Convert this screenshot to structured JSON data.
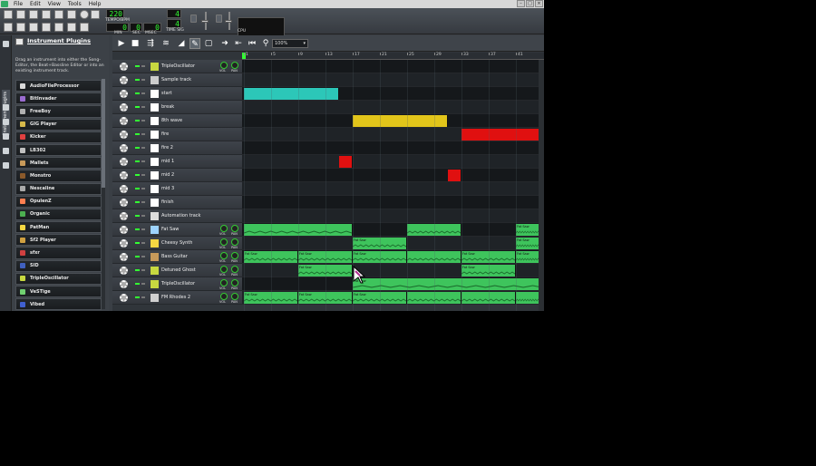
{
  "menubar": {
    "items": [
      "File",
      "Edit",
      "View",
      "Tools",
      "Help"
    ],
    "window_buttons": [
      "–",
      "□",
      "×"
    ]
  },
  "toolbar": {
    "tempo": "220",
    "tempo_label": "TEMPO/BPM",
    "time_min": "0",
    "time_sec": "0",
    "time_msec": "0",
    "min_label": "MIN",
    "sec_label": "SEC",
    "msec_label": "MSEC",
    "timesig_num": "4",
    "timesig_den": "4",
    "timesig_label": "TIME SIG",
    "cpu_label": "CPU"
  },
  "side_tab": {
    "label": "Instrument Plugins"
  },
  "plugins": {
    "title": "Instrument Plugins",
    "description": "Drag an instrument into either the Song-Editor, the Beat+Bassline Editor or into an existing instrument track.",
    "items": [
      {
        "name": "AudioFileProcessor",
        "color": "#d9d9d9"
      },
      {
        "name": "BitInvader",
        "color": "#9a6cd0"
      },
      {
        "name": "FreeBoy",
        "color": "#b0b0b0"
      },
      {
        "name": "GIG Player",
        "color": "#d7b94a"
      },
      {
        "name": "Kicker",
        "color": "#e04040"
      },
      {
        "name": "LB302",
        "color": "#c0c0c0"
      },
      {
        "name": "Mallets",
        "color": "#c89a5a"
      },
      {
        "name": "Monstro",
        "color": "#8b5a2b"
      },
      {
        "name": "Nescaline",
        "color": "#aaaaaa"
      },
      {
        "name": "OpulenZ",
        "color": "#ff7f50"
      },
      {
        "name": "Organic",
        "color": "#4caf50"
      },
      {
        "name": "PatMan",
        "color": "#f5d742"
      },
      {
        "name": "Sf2 Player",
        "color": "#d0a040"
      },
      {
        "name": "sfxr",
        "color": "#d04040"
      },
      {
        "name": "SID",
        "color": "#4060c0"
      },
      {
        "name": "TripleOscillator",
        "color": "#c8d840"
      },
      {
        "name": "VeSTige",
        "color": "#70d070"
      },
      {
        "name": "Vibed",
        "color": "#4060d0"
      }
    ]
  },
  "song_editor": {
    "zoom": "100%",
    "timeline_ticks": [
      "1",
      "5",
      "9",
      "13",
      "17",
      "21",
      "25",
      "29",
      "33",
      "37",
      "41"
    ],
    "tracks": [
      {
        "name": "TripleOscillator",
        "type": "instrument",
        "icon_color": "#c8d840",
        "knobs": true
      },
      {
        "name": "Sample track",
        "type": "sample",
        "icon_color": "#cccccc",
        "knobs": false
      },
      {
        "name": "start",
        "type": "bb",
        "icon_color": "#ffffff",
        "knobs": false
      },
      {
        "name": "break",
        "type": "bb",
        "icon_color": "#ffffff",
        "knobs": false
      },
      {
        "name": "8th wave",
        "type": "bb",
        "icon_color": "#ffffff",
        "knobs": false
      },
      {
        "name": "fire",
        "type": "bb",
        "icon_color": "#ffffff",
        "knobs": false
      },
      {
        "name": "fire 2",
        "type": "bb",
        "icon_color": "#ffffff",
        "knobs": false
      },
      {
        "name": "mid 1",
        "type": "bb",
        "icon_color": "#ffffff",
        "knobs": false
      },
      {
        "name": "mid 2",
        "type": "bb",
        "icon_color": "#ffffff",
        "knobs": false
      },
      {
        "name": "mid 3",
        "type": "bb",
        "icon_color": "#ffffff",
        "knobs": false
      },
      {
        "name": "finish",
        "type": "bb",
        "icon_color": "#ffffff",
        "knobs": false
      },
      {
        "name": "Automation track",
        "type": "automation",
        "icon_color": "#dddddd",
        "knobs": false
      },
      {
        "name": "Fat Saw",
        "type": "instrument",
        "icon_color": "#9dd3ff",
        "knobs": true
      },
      {
        "name": "Cheesy Synth",
        "type": "instrument",
        "icon_color": "#f5d742",
        "knobs": true
      },
      {
        "name": "Bass Guitar",
        "type": "instrument",
        "icon_color": "#c89a5a",
        "knobs": true
      },
      {
        "name": "Detuned Ghost",
        "type": "instrument",
        "icon_color": "#c8d840",
        "knobs": true
      },
      {
        "name": "TripleOscillator",
        "type": "instrument",
        "icon_color": "#c8d840",
        "knobs": true
      },
      {
        "name": "FM Rhodes 2",
        "type": "instrument",
        "icon_color": "#d0d0d0",
        "knobs": true
      }
    ],
    "knob_labels": {
      "vol": "VOL",
      "pan": "PAN"
    },
    "patterns": [
      {
        "track": 2,
        "start": 1,
        "len": 14,
        "color": "#2cc7b8",
        "label": ""
      },
      {
        "track": 4,
        "start": 17,
        "len": 14,
        "color": "#e2c51a",
        "label": ""
      },
      {
        "track": 5,
        "start": 33,
        "len": 12,
        "color": "#e01010",
        "label": ""
      },
      {
        "track": 7,
        "start": 15,
        "len": 2,
        "color": "#e01010",
        "label": ""
      },
      {
        "track": 8,
        "start": 31,
        "len": 2,
        "color": "#e01010",
        "label": ""
      },
      {
        "track": 12,
        "start": 1,
        "len": 16,
        "color": "#3ec45c",
        "label": ""
      },
      {
        "track": 12,
        "start": 25,
        "len": 8,
        "color": "#3ec45c",
        "label": ""
      },
      {
        "track": 12,
        "start": 41,
        "len": 4,
        "color": "#3ec45c",
        "label": "Fat Saw"
      },
      {
        "track": 13,
        "start": 17,
        "len": 8,
        "color": "#3ec45c",
        "label": "Fat Saw"
      },
      {
        "track": 13,
        "start": 41,
        "len": 4,
        "color": "#3ec45c",
        "label": "Fat Saw"
      },
      {
        "track": 14,
        "start": 1,
        "len": 8,
        "color": "#3ec45c",
        "label": "Fat Saw"
      },
      {
        "track": 14,
        "start": 9,
        "len": 8,
        "color": "#3ec45c",
        "label": "Fat Saw"
      },
      {
        "track": 14,
        "start": 17,
        "len": 8,
        "color": "#3ec45c",
        "label": "Fat Saw"
      },
      {
        "track": 14,
        "start": 25,
        "len": 8,
        "color": "#3ec45c",
        "label": ""
      },
      {
        "track": 14,
        "start": 33,
        "len": 8,
        "color": "#3ec45c",
        "label": "Fat Saw"
      },
      {
        "track": 14,
        "start": 41,
        "len": 4,
        "color": "#3ec45c",
        "label": "Fat Saw"
      },
      {
        "track": 15,
        "start": 9,
        "len": 8,
        "color": "#3ec45c",
        "label": "Fat Saw"
      },
      {
        "track": 15,
        "start": 33,
        "len": 8,
        "color": "#3ec45c",
        "label": "Fat Saw"
      },
      {
        "track": 16,
        "start": 17,
        "len": 28,
        "color": "#3ec45c",
        "label": "Fat Saw"
      },
      {
        "track": 17,
        "start": 1,
        "len": 8,
        "color": "#3ec45c",
        "label": "Fat Saw"
      },
      {
        "track": 17,
        "start": 9,
        "len": 8,
        "color": "#3ec45c",
        "label": "Fat Saw"
      },
      {
        "track": 17,
        "start": 17,
        "len": 8,
        "color": "#3ec45c",
        "label": "Fat Saw"
      },
      {
        "track": 17,
        "start": 25,
        "len": 8,
        "color": "#3ec45c",
        "label": ""
      },
      {
        "track": 17,
        "start": 33,
        "len": 8,
        "color": "#3ec45c",
        "label": ""
      },
      {
        "track": 17,
        "start": 41,
        "len": 4,
        "color": "#3ec45c",
        "label": ""
      }
    ]
  }
}
